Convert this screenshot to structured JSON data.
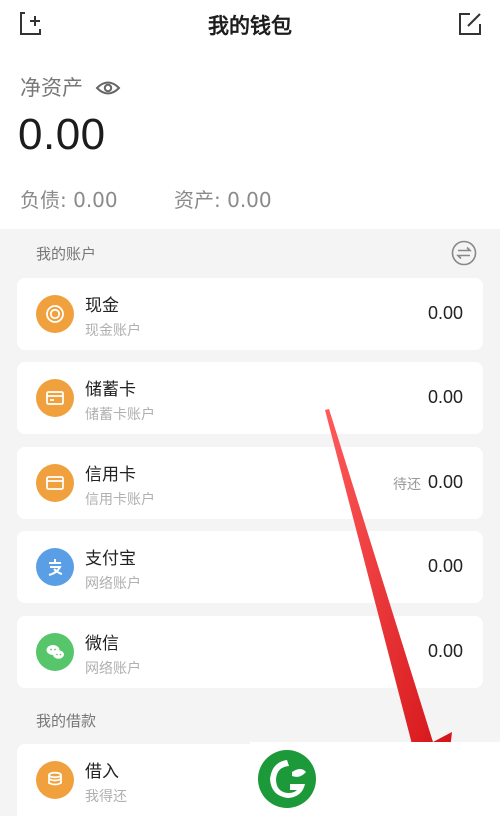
{
  "header": {
    "title": "我的钱包",
    "add_icon": "add-square-icon",
    "edit_icon": "edit-icon"
  },
  "summary": {
    "net_assets_label": "净资产",
    "net_assets_value": "0.00",
    "debt_text": "负债: 0.00",
    "assets_text": "资产: 0.00"
  },
  "accounts": {
    "section_title": "我的账户",
    "items": [
      {
        "name": "现金",
        "sub": "现金账户",
        "amount": "0.00",
        "icon": "coin-icon"
      },
      {
        "name": "储蓄卡",
        "sub": "储蓄卡账户",
        "amount": "0.00",
        "icon": "debit-card-icon"
      },
      {
        "name": "信用卡",
        "sub": "信用卡账户",
        "amount": "0.00",
        "pending": "待还",
        "icon": "credit-card-icon"
      },
      {
        "name": "支付宝",
        "sub": "网络账户",
        "amount": "0.00",
        "icon": "alipay-icon"
      },
      {
        "name": "微信",
        "sub": "网络账户",
        "amount": "0.00",
        "icon": "wechat-icon"
      }
    ]
  },
  "loans": {
    "section_title": "我的借款",
    "items": [
      {
        "name": "借入",
        "sub": "我得还",
        "icon": "coin-stack-icon"
      }
    ]
  },
  "colors": {
    "orange": "#f0a13d",
    "alipay_blue": "#5a9fe6",
    "wechat_green": "#57c56a",
    "arrow_red": "#e0161b"
  }
}
